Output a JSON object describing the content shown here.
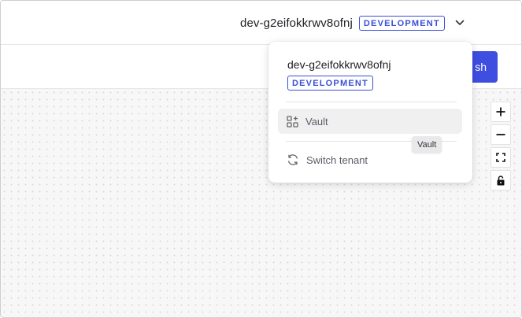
{
  "header": {
    "tenant_name": "dev-g2eifokkrwv8ofnj",
    "environment_badge": "DEVELOPMENT"
  },
  "toolbar": {
    "publish_label_visible": "sh"
  },
  "dropdown": {
    "tenant_name": "dev-g2eifokkrwv8ofnj",
    "environment_badge": "DEVELOPMENT",
    "items": [
      {
        "label": "Vault",
        "icon": "vault-icon",
        "hovered": true
      },
      {
        "label": "Switch tenant",
        "icon": "refresh-icon",
        "hovered": false
      }
    ]
  },
  "tooltip": {
    "text": "Vault"
  },
  "zoom_controls": {
    "items": [
      {
        "icon": "plus-icon"
      },
      {
        "icon": "minus-icon"
      },
      {
        "icon": "fit-view-icon"
      },
      {
        "icon": "lock-icon"
      }
    ]
  },
  "colors": {
    "accent": "#3d4ee0",
    "badge": "#3b4fd6",
    "canvas": "#f7f7f8"
  }
}
